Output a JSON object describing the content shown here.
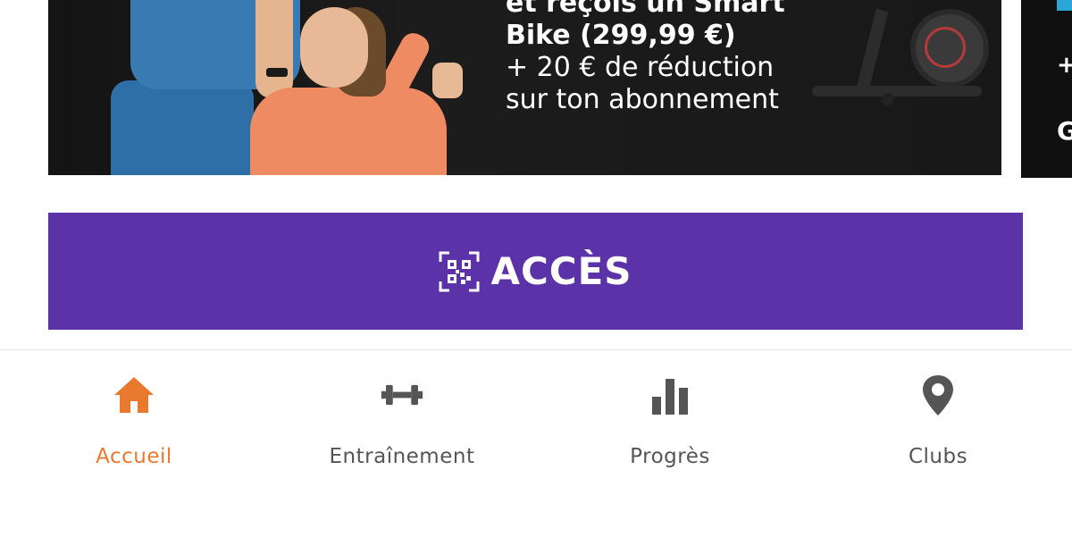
{
  "promo_banner": {
    "lines": [
      "et reçois un Smart",
      "Bike (299,99 €)",
      "+ 20 € de réduction",
      "sur ton abonnement"
    ]
  },
  "promo_banner_next": {
    "peek_line": "+",
    "peek_g": "G"
  },
  "access_button": {
    "label": "ACCÈS",
    "icon": "qr-code-icon",
    "color": "#5b32a8"
  },
  "bottom_nav": {
    "active_color": "#e8792f",
    "inactive_color": "#555555",
    "items": [
      {
        "label": "Accueil",
        "icon": "home-icon",
        "active": true
      },
      {
        "label": "Entraînement",
        "icon": "dumbbell-icon",
        "active": false
      },
      {
        "label": "Progrès",
        "icon": "bar-chart-icon",
        "active": false
      },
      {
        "label": "Clubs",
        "icon": "map-pin-icon",
        "active": false
      }
    ]
  }
}
